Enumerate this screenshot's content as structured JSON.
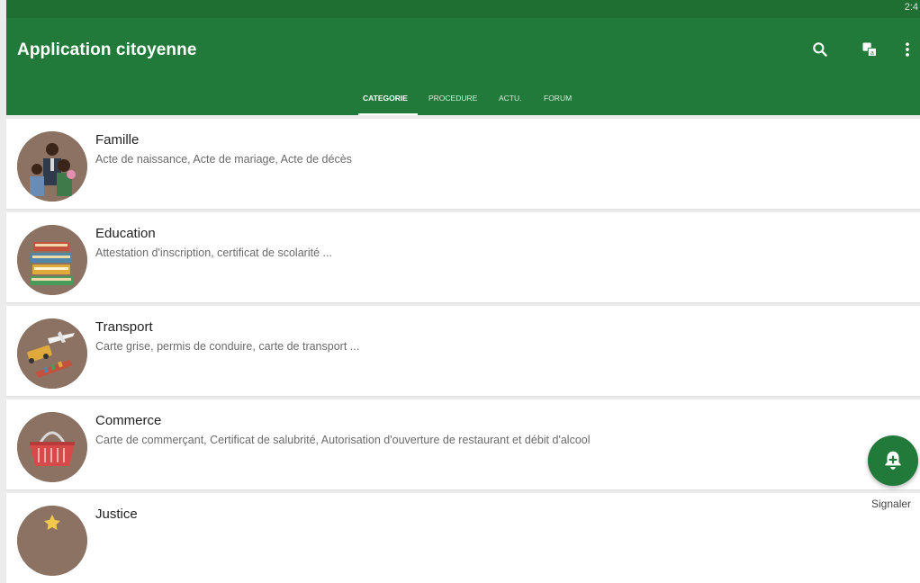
{
  "status_bar": {
    "time": "2:4"
  },
  "app_bar": {
    "title": "Application citoyenne"
  },
  "tabs": [
    {
      "label": "CATEGORIE",
      "active": true
    },
    {
      "label": "PROCEDURE",
      "active": false
    },
    {
      "label": "ACTU.",
      "active": false
    },
    {
      "label": "FORUM",
      "active": false
    }
  ],
  "categories": [
    {
      "name": "Famille",
      "description": "Acte de naissance, Acte de mariage, Acte de décès",
      "icon": "family-icon"
    },
    {
      "name": "Education",
      "description": "Attestation d'inscription, certificat de scolarité ...",
      "icon": "books-icon"
    },
    {
      "name": "Transport",
      "description": "Carte grise, permis de conduire, carte de transport ...",
      "icon": "transport-icon"
    },
    {
      "name": "Commerce",
      "description": "Carte de commerçant, Certificat de salubrité, Autorisation d'ouverture de restaurant et débit d'alcool",
      "icon": "basket-icon"
    },
    {
      "name": "Justice",
      "description": "",
      "icon": "justice-icon"
    }
  ],
  "fab": {
    "label": "Signaler",
    "icon": "add-alert-icon"
  },
  "colors": {
    "primary": "#217a39",
    "primary_dark": "#1f6e32",
    "background": "#ececec",
    "avatar_bg": "#8c7262"
  }
}
